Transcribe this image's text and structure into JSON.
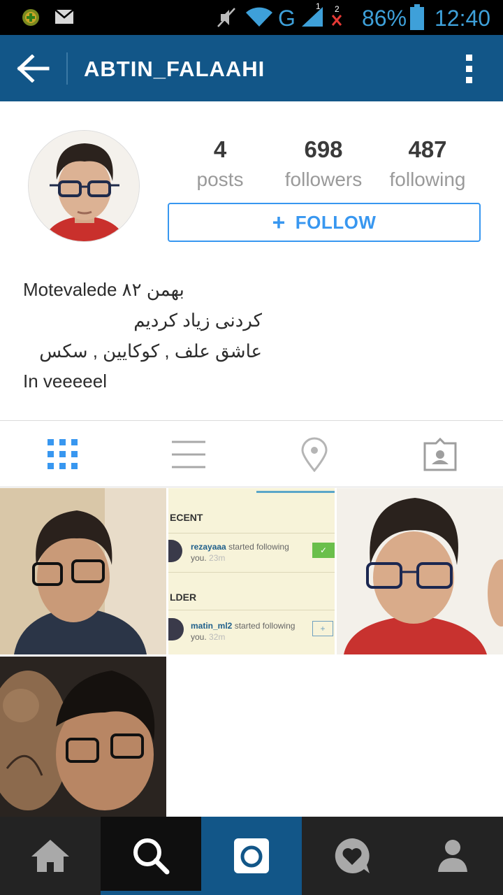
{
  "status_bar": {
    "network_label": "G",
    "sim1": "1",
    "sim2": "2",
    "battery": "86%",
    "time": "12:40",
    "icons": [
      "app-badge-icon",
      "mail-icon",
      "mute-icon",
      "wifi-icon",
      "signal-icon",
      "no-signal-icon",
      "battery-icon"
    ]
  },
  "app_bar": {
    "title": "ABTIN_FALAAHI",
    "back_icon": "back-arrow-icon",
    "menu_icon": "overflow-menu-icon"
  },
  "profile": {
    "stats": [
      {
        "value": "4",
        "label": "posts"
      },
      {
        "value": "698",
        "label": "followers"
      },
      {
        "value": "487",
        "label": "following"
      }
    ],
    "follow_button": {
      "icon": "+",
      "label": "FOLLOW"
    },
    "bio_lines": [
      "Motevalede بهمن ۸۲",
      "کردنی زیاد کردیم",
      "عاشق علف , کوکایین , سکس",
      "In veeeeel"
    ]
  },
  "tabs": [
    {
      "name": "grid-view-icon",
      "active": true
    },
    {
      "name": "list-view-icon",
      "active": false
    },
    {
      "name": "location-pin-icon",
      "active": false
    },
    {
      "name": "tagged-photos-icon",
      "active": false
    }
  ],
  "posts": {
    "screenshot_post": {
      "header1": "ECENT",
      "item1_user": "rezayaaa",
      "item1_text": "started following",
      "item1_text2": "you.",
      "item1_time": "23m",
      "header2": "LDER",
      "item2_user": "matin_ml2",
      "item2_text": "started following",
      "item2_text2": "you.",
      "item2_time": "32m"
    }
  },
  "bottom_nav": [
    {
      "name": "home-icon",
      "active": false
    },
    {
      "name": "search-icon",
      "active": true
    },
    {
      "name": "camera-icon",
      "active": false
    },
    {
      "name": "activity-heart-icon",
      "active": false
    },
    {
      "name": "profile-icon",
      "active": false
    }
  ],
  "colors": {
    "app_bar": "#125688",
    "accent": "#3897f0",
    "status_text": "#3ea0d9",
    "nav_bg": "#232323",
    "nav_active": "#0f0f0f",
    "nav_camera": "#125688"
  }
}
